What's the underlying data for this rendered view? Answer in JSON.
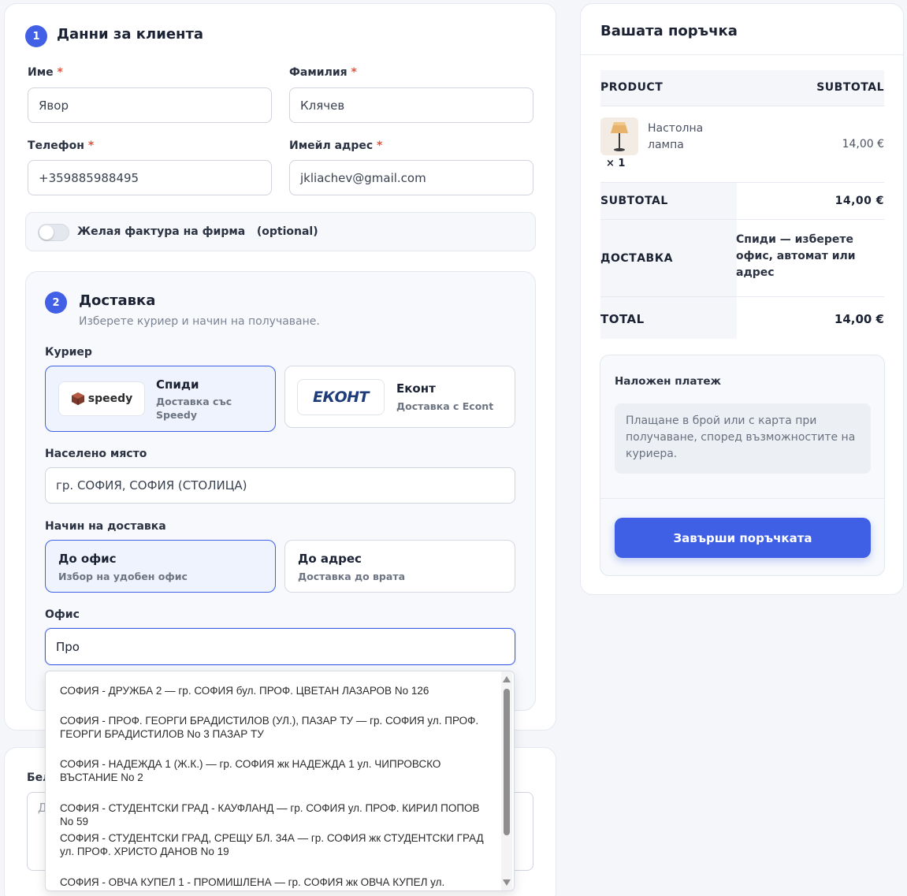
{
  "customer": {
    "step_number": "1",
    "title": "Данни за клиента",
    "required_mark": "*",
    "first_name_label": "Име",
    "first_name_value": "Явор",
    "last_name_label": "Фамилия",
    "last_name_value": "Клячев",
    "phone_label": "Телефон",
    "phone_value": "+359885988495",
    "email_label": "Имейл адрес",
    "email_value": "jkliachev@gmail.com",
    "invoice_label": "Желая фактура на фирма",
    "invoice_optional": "(optional)",
    "invoice_enabled": false
  },
  "delivery": {
    "step_number": "2",
    "title": "Доставка",
    "subtitle": "Изберете куриер и начин на получаване.",
    "courier_label": "Куриер",
    "couriers": [
      {
        "logo_text": "speedy",
        "name": "Спиди",
        "sub": "Доставка със Speedy",
        "selected": true
      },
      {
        "logo_text": "ЕКОНТ",
        "name": "Еконт",
        "sub": "Доставка с Econt",
        "selected": false
      }
    ],
    "city_label": "Населено място",
    "city_value": "гр. СОФИЯ, СОФИЯ (СТОЛИЦА)",
    "method_label": "Начин на доставка",
    "methods": [
      {
        "name": "До офис",
        "sub": "Избор на удобен офис",
        "selected": true
      },
      {
        "name": "До адрес",
        "sub": "Доставка до врата",
        "selected": false
      }
    ],
    "office_label": "Офис",
    "office_value": "Про",
    "office_suggestions": [
      "СОФИЯ - ДРУЖБА 2 — гр. СОФИЯ бул. ПРОФ. ЦВЕТАН ЛАЗАРОВ No 126",
      "СОФИЯ - ПРОФ. ГЕОРГИ БРАДИСТИЛОВ (УЛ.), ПАЗАР ТУ — гр. СОФИЯ ул. ПРОФ. ГЕОРГИ БРАДИСТИЛОВ No 3 ПАЗАР ТУ",
      "СОФИЯ - НАДЕЖДА 1 (Ж.К.) — гр. СОФИЯ жк НАДЕЖДА 1 ул. ЧИПРОВСКО ВЪСТАНИЕ No 2",
      "СОФИЯ - СТУДЕНТСКИ ГРАД - КАУФЛАНД — гр. СОФИЯ ул. ПРОФ. КИРИЛ ПОПОВ No 59",
      "СОФИЯ - СТУДЕНТСКИ ГРАД, СРЕЩУ БЛ. 34А — гр. СОФИЯ жк СТУДЕНТСКИ ГРАД ул. ПРОФ. ХРИСТО ДАНОВ No 19",
      "СОФИЯ - ОВЧА КУПЕЛ 1 - ПРОМИШЛЕНА — гр. СОФИЯ жк ОВЧА КУПЕЛ ул."
    ]
  },
  "notes": {
    "label_partial": "Бел",
    "placeholder_partial": "Д"
  },
  "order": {
    "title": "Вашата поръчка",
    "col_product": "PRODUCT",
    "col_subtotal": "SUBTOTAL",
    "item_name_line1": "Настолна",
    "item_name_line2": "лампа",
    "item_qty": "× 1",
    "item_price": "14,00 €",
    "subtotal_label": "SUBTOTAL",
    "subtotal_value": "14,00 €",
    "shipping_label": "ДОСТАВКА",
    "shipping_value": "Спиди — изберете офис, автомат или адрес",
    "total_label": "TOTAL",
    "total_value": "14,00 €"
  },
  "payment": {
    "method_title": "Наложен платеж",
    "note": "Плащане в брой или с карта при получаване, според възможностите на куриера.",
    "submit_label": "Завърши поръчката"
  },
  "colors": {
    "accent": "#3f5fe5",
    "required": "#e0533d"
  }
}
